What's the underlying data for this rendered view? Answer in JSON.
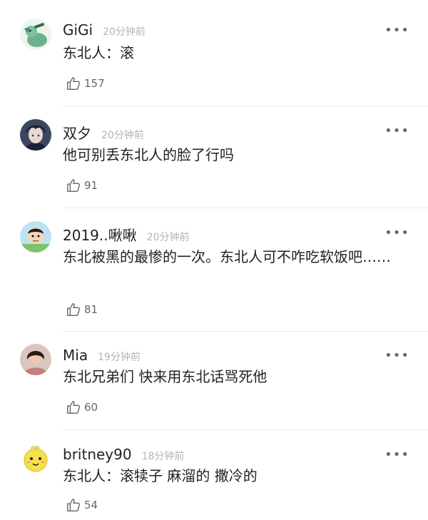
{
  "comments": [
    {
      "username": "GiGi",
      "time": "20分钟前",
      "text": "东北人：滚",
      "likes": "157",
      "avatar_icon": "dinosaur-avatar"
    },
    {
      "username": "双夕",
      "time": "20分钟前",
      "text": "他可别丢东北人的脸了行吗",
      "likes": "91",
      "avatar_icon": "anime-boy-avatar"
    },
    {
      "username": "2019..啾啾",
      "time": "20分钟前",
      "text": "东北被黑的最惨的一次。东北人可不咋吃软饭吧……",
      "likes": "81",
      "avatar_icon": "cartoon-kid-avatar"
    },
    {
      "username": "Mia",
      "time": "19分钟前",
      "text": "东北兄弟们 快来用东北话骂死他",
      "likes": "60",
      "avatar_icon": "girl-photo-avatar"
    },
    {
      "username": "britney90",
      "time": "18分钟前",
      "text": "东北人：滚犊子 麻溜的 撒冷的",
      "likes": "54",
      "avatar_icon": "yellow-chick-avatar"
    }
  ],
  "more_label": "•••",
  "like_icon": "thumbs-up-icon",
  "colors": {
    "text": "#222222",
    "meta": "#b3b3b3",
    "divider": "#ececec"
  }
}
